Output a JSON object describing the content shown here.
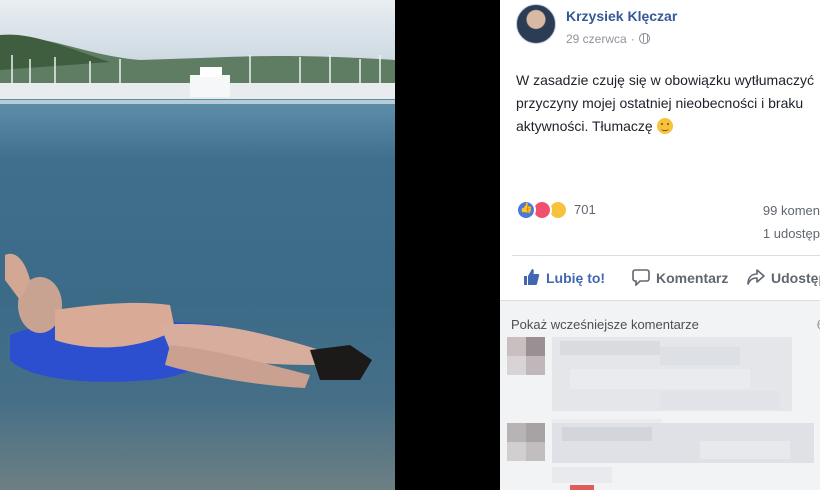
{
  "post": {
    "author": "Krzysiek Klęczar",
    "date": "29 czerwca",
    "separator": "·",
    "text": "W zasadzie czuję się w obowiązku wytłumaczyć przyczyny mojej ostatniej nieobecności i braku aktywności. Tłumaczę",
    "emoji_icon": "smirk-emoji-icon"
  },
  "stats": {
    "reactions_count": "701",
    "comments": "99 komen",
    "shares": "1 udostęp"
  },
  "actions": {
    "like": "Lubię to!",
    "comment": "Komentarz",
    "share": "Udostęp"
  },
  "comments": {
    "show_previous": "Pokaż wcześniejsze komentarze",
    "count_fragment": "6"
  },
  "colors": {
    "link_blue": "#365899",
    "like_blue": "#4267b2",
    "text": "#1d2129",
    "muted": "#90949c",
    "comments_bg": "#f2f3f5"
  }
}
